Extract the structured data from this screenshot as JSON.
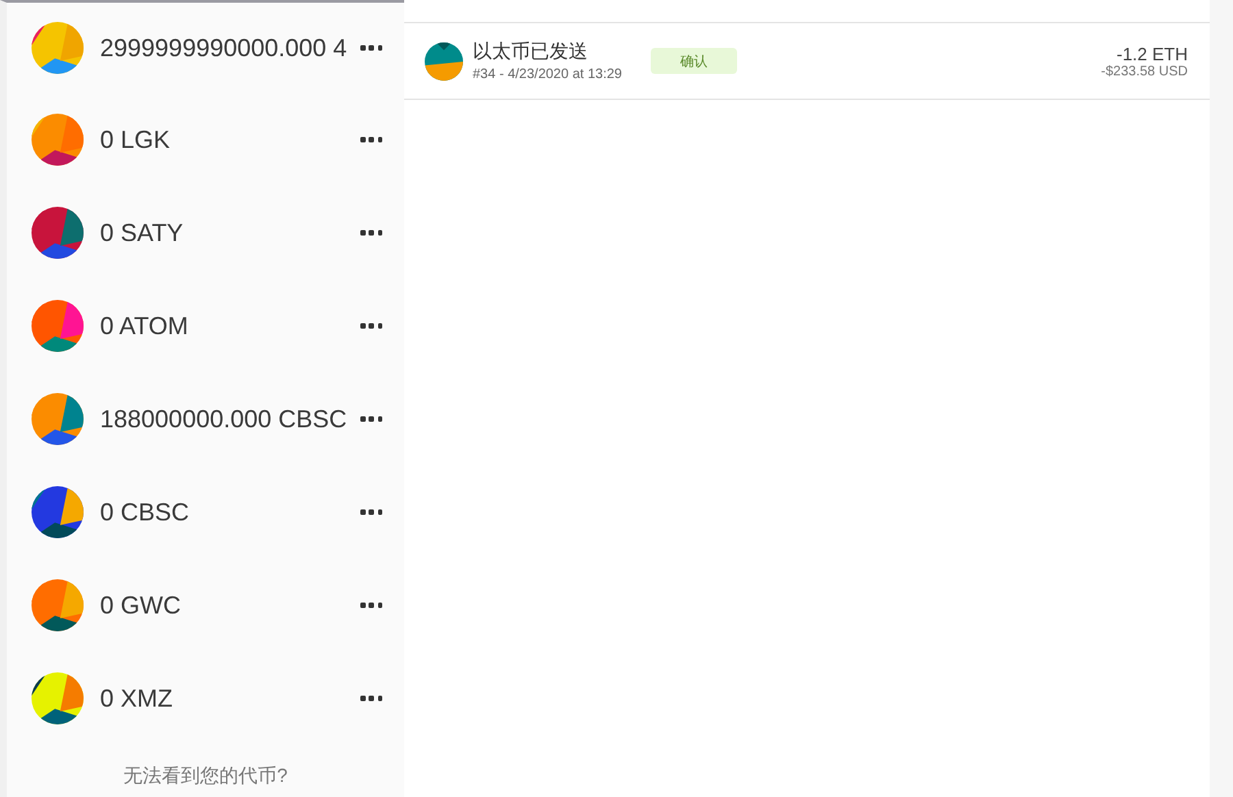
{
  "tokens": [
    {
      "amount": "2999999990000.000 4"
    },
    {
      "amount": "0 LGK"
    },
    {
      "amount": "0 SATY"
    },
    {
      "amount": "0 ATOM"
    },
    {
      "amount": "188000000.000 CBSC"
    },
    {
      "amount": "0 CBSC"
    },
    {
      "amount": "0 GWC"
    },
    {
      "amount": "0 XMZ"
    }
  ],
  "missing_token_link": "无法看到您的代币?",
  "transactions": [
    {
      "title": "以太币已发送",
      "subtitle": "#34 - 4/23/2020 at 13:29",
      "status": "确认",
      "amount": "-1.2 ETH",
      "fiat": "-$233.58 USD"
    }
  ]
}
